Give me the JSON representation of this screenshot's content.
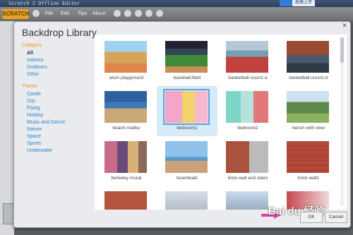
{
  "window": {
    "title": "Scratch 2 Offline Editor",
    "upload_label": "拖拽上传"
  },
  "menu": {
    "logo": "SCRATCH",
    "items": [
      "File",
      "Edit",
      "Tips",
      "About"
    ]
  },
  "dialog": {
    "title": "Backdrop Library",
    "category": {
      "heading": "Category",
      "items": [
        "All",
        "Indoors",
        "Outdoors",
        "Other"
      ]
    },
    "theme": {
      "heading": "Theme",
      "items": [
        "Castle",
        "City",
        "Flying",
        "Holiday",
        "Music and Dance",
        "Nature",
        "Space",
        "Sports",
        "Underwater"
      ]
    },
    "backdrops": [
      "atom playground",
      "baseball-field",
      "basketball-court1-a",
      "basketball-court1-b",
      "beach malibu",
      "bedroom1",
      "bedroom2",
      "bench with view",
      "berkeley mural",
      "boardwalk",
      "brick wall and stairs",
      "brick wall1",
      "",
      "",
      "",
      ""
    ],
    "selected": "bedroom1",
    "ok_label": "OK",
    "cancel_label": "Cancel"
  },
  "watermark": "Bai du 经验",
  "colors": {
    "accent": "#2c85c9",
    "category_heading": "#e59a2a",
    "selection": "#5aa5d6"
  }
}
